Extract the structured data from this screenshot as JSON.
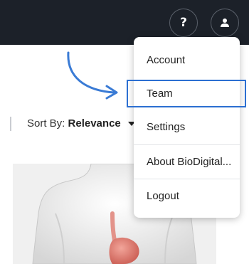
{
  "header": {
    "help_glyph": "?",
    "icons": {
      "help": "question-mark-icon",
      "user": "user-icon"
    }
  },
  "sort": {
    "label": "Sort By:",
    "value": "Relevance"
  },
  "menu": {
    "items": [
      {
        "label": "Account"
      },
      {
        "label": "Team"
      },
      {
        "label": "Settings"
      },
      {
        "label": "About BioDigital..."
      },
      {
        "label": "Logout"
      }
    ]
  },
  "colors": {
    "topbar": "#1c2129",
    "highlight": "#2c6fd1",
    "arrow": "#3a7bd5"
  }
}
